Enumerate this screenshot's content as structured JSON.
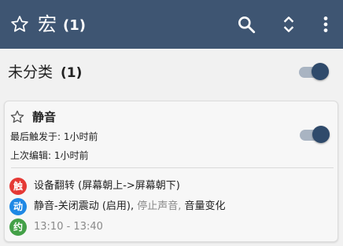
{
  "appbar": {
    "title": "宏",
    "count": "(1)",
    "icons": [
      "star-outline-icon",
      "search-icon",
      "unfold-icon",
      "more-vert-icon"
    ],
    "background": "#3e5572"
  },
  "section": {
    "label": "未分类",
    "count": "(1)",
    "enabled": true
  },
  "macro": {
    "name": "静音",
    "last_triggered": "最后触发于: 1小时前",
    "last_edited": "上次编辑: 1小时前",
    "enabled": true,
    "trigger": {
      "badge": "触",
      "color": "#e53935",
      "text": "设备翻转 (屏幕朝上->屏幕朝下)"
    },
    "action": {
      "badge": "动",
      "color": "#1e88e5",
      "text_main": "静音-关闭震动 (启用),",
      "text_rest": " 停止声音,",
      "text_tail": " 音量变化"
    },
    "constraint": {
      "badge": "约",
      "color": "#43a047",
      "text": "13:10 - 13:40"
    }
  }
}
